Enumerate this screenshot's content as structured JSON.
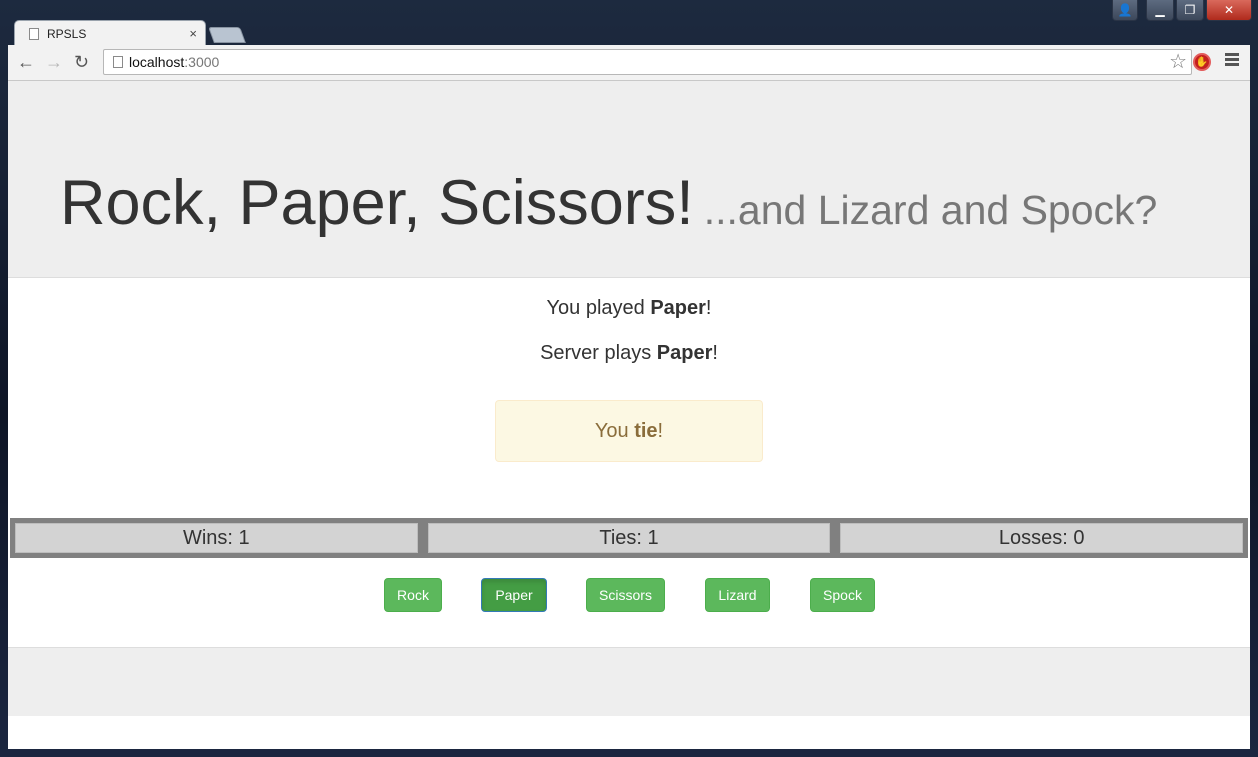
{
  "browser": {
    "tab_title": "RPSLS",
    "tab_close": "×",
    "url_host": "localhost",
    "url_port": ":3000",
    "window_controls": {
      "minimize": "▁",
      "maximize": "❐",
      "close": "✕"
    }
  },
  "header": {
    "title": "Rock, Paper, Scissors!",
    "subtitle": "...and Lizard and Spock?"
  },
  "game": {
    "you_played_prefix": "You played ",
    "you_played_choice": "Paper",
    "you_played_suffix": "!",
    "server_plays_prefix": "Server plays ",
    "server_plays_choice": "Paper",
    "server_plays_suffix": "!",
    "result_prefix": "You ",
    "result_word": "tie",
    "result_suffix": "!"
  },
  "scores": {
    "wins": "Wins: 1",
    "ties": "Ties: 1",
    "losses": "Losses: 0"
  },
  "choices": [
    "Rock",
    "Paper",
    "Scissors",
    "Lizard",
    "Spock"
  ],
  "active_choice": "Paper",
  "colors": {
    "button_green": "#5cb85c",
    "button_active": "#449d44",
    "alert_bg": "#fcf8e3",
    "alert_text": "#8a6d3b"
  }
}
